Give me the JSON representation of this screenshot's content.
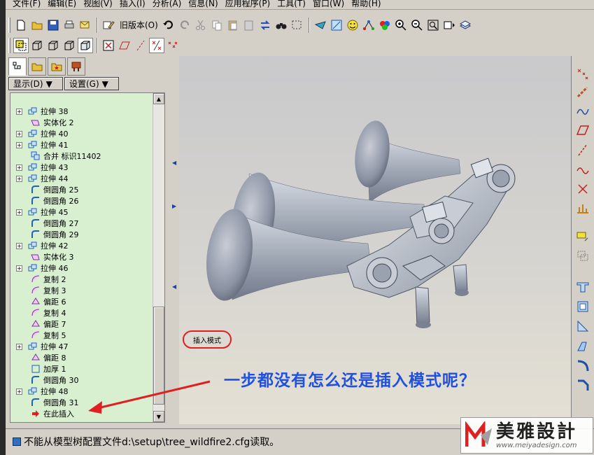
{
  "menubar": {
    "items": [
      "文件(F)",
      "编辑(E)",
      "视图(V)",
      "插入(I)",
      "分析(A)",
      "信息(N)",
      "应用程序(P)",
      "工具(T)",
      "窗口(W)",
      "帮助(H)"
    ]
  },
  "toolbar": {
    "old_version_label": "旧版本(O)"
  },
  "leftpanel": {
    "show_button": "显示(D)",
    "settings_button": "设置(G)"
  },
  "tree": {
    "items": [
      {
        "label": "拉伸 38",
        "kind": "extrude",
        "expandable": true
      },
      {
        "label": "实体化 2",
        "kind": "solidify",
        "expandable": false
      },
      {
        "label": "拉伸 40",
        "kind": "extrude",
        "expandable": true
      },
      {
        "label": "拉伸 41",
        "kind": "extrude",
        "expandable": true
      },
      {
        "label": "合并 标识11402",
        "kind": "merge",
        "expandable": false
      },
      {
        "label": "拉伸 43",
        "kind": "extrude",
        "expandable": true
      },
      {
        "label": "拉伸 44",
        "kind": "extrude",
        "expandable": true
      },
      {
        "label": "倒圆角 25",
        "kind": "round",
        "expandable": false
      },
      {
        "label": "倒圆角 26",
        "kind": "round",
        "expandable": false
      },
      {
        "label": "拉伸 45",
        "kind": "extrude",
        "expandable": true
      },
      {
        "label": "倒圆角 27",
        "kind": "round",
        "expandable": false
      },
      {
        "label": "倒圆角 29",
        "kind": "round",
        "expandable": false
      },
      {
        "label": "拉伸 42",
        "kind": "extrude",
        "expandable": true
      },
      {
        "label": "实体化 3",
        "kind": "solidify",
        "expandable": false
      },
      {
        "label": "拉伸 46",
        "kind": "extrude",
        "expandable": true
      },
      {
        "label": "复制 2",
        "kind": "copy",
        "expandable": false
      },
      {
        "label": "复制 3",
        "kind": "copy",
        "expandable": false
      },
      {
        "label": "偏距 6",
        "kind": "offset",
        "expandable": false
      },
      {
        "label": "复制 4",
        "kind": "copy",
        "expandable": false
      },
      {
        "label": "偏距 7",
        "kind": "offset",
        "expandable": false
      },
      {
        "label": "复制 5",
        "kind": "copy",
        "expandable": false
      },
      {
        "label": "拉伸 47",
        "kind": "extrude",
        "expandable": true
      },
      {
        "label": "偏距 8",
        "kind": "offset",
        "expandable": false
      },
      {
        "label": "加厚 1",
        "kind": "thicken",
        "expandable": false
      },
      {
        "label": "倒圆角 30",
        "kind": "round",
        "expandable": false
      },
      {
        "label": "拉伸 48",
        "kind": "extrude",
        "expandable": true
      },
      {
        "label": "倒圆角 31",
        "kind": "round",
        "expandable": false
      },
      {
        "label": "在此插入",
        "kind": "insert-here",
        "expandable": false
      }
    ]
  },
  "viewport": {
    "mode_label": "插入模式",
    "annotation": "一步都没有怎么还是插入模式呢？"
  },
  "statusbar": {
    "message": "不能从模型树配置文件d:\\setup\\tree_wildfire2.cfg读取。"
  },
  "watermark": {
    "name": "美雅設計",
    "url": "www.meiyadesign.com"
  },
  "colors": {
    "tree_bg": "#d8efd0",
    "annotation": "#2050e0",
    "highlight_red": "#e02020"
  }
}
